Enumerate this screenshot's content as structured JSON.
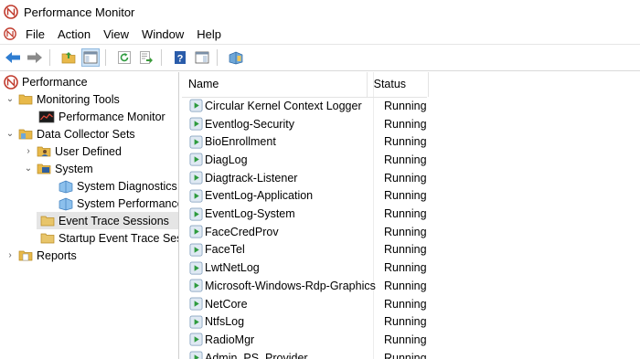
{
  "window": {
    "title": "Performance Monitor"
  },
  "menu": [
    "File",
    "Action",
    "View",
    "Window",
    "Help"
  ],
  "toolbar": {
    "buttons": [
      "back-icon",
      "forward-icon",
      "up-folder-icon",
      "show-hide-tree-icon",
      "refresh-icon",
      "export-list-icon",
      "help-icon",
      "properties-icon",
      "new-window-icon"
    ]
  },
  "tree": [
    {
      "label": "Performance",
      "icon": "performance-icon",
      "expander": ""
    },
    {
      "label": "Monitoring Tools",
      "icon": "folder-icon",
      "expander": "⌄"
    },
    {
      "label": "Performance Monitor",
      "icon": "monitor-chart-icon",
      "expander": ""
    },
    {
      "label": "Data Collector Sets",
      "icon": "data-collector-icon",
      "expander": "⌄"
    },
    {
      "label": "User Defined",
      "icon": "user-folder-icon",
      "expander": "›"
    },
    {
      "label": "System",
      "icon": "system-folder-icon",
      "expander": "⌄"
    },
    {
      "label": "System Diagnostics",
      "icon": "collector-set-icon",
      "expander": ""
    },
    {
      "label": "System Performance",
      "icon": "collector-set-icon",
      "expander": ""
    },
    {
      "label": "Event Trace Sessions",
      "icon": "trace-folder-icon",
      "expander": ""
    },
    {
      "label": "Startup Event Trace Sessions",
      "icon": "trace-folder-icon",
      "expander": ""
    },
    {
      "label": "Reports",
      "icon": "reports-icon",
      "expander": "›"
    }
  ],
  "list": {
    "columns": {
      "name": "Name",
      "status": "Status"
    },
    "rows": [
      {
        "name": "Circular Kernel Context Logger",
        "status": "Running"
      },
      {
        "name": "Eventlog-Security",
        "status": "Running"
      },
      {
        "name": "BioEnrollment",
        "status": "Running"
      },
      {
        "name": "DiagLog",
        "status": "Running"
      },
      {
        "name": "Diagtrack-Listener",
        "status": "Running"
      },
      {
        "name": "EventLog-Application",
        "status": "Running"
      },
      {
        "name": "EventLog-System",
        "status": "Running"
      },
      {
        "name": "FaceCredProv",
        "status": "Running"
      },
      {
        "name": "FaceTel",
        "status": "Running"
      },
      {
        "name": "LwtNetLog",
        "status": "Running"
      },
      {
        "name": "Microsoft-Windows-Rdp-Graphics",
        "status": "Running"
      },
      {
        "name": "NetCore",
        "status": "Running"
      },
      {
        "name": "NtfsLog",
        "status": "Running"
      },
      {
        "name": "RadioMgr",
        "status": "Running"
      },
      {
        "name": "Admin_PS_Provider",
        "status": "Running"
      }
    ]
  }
}
